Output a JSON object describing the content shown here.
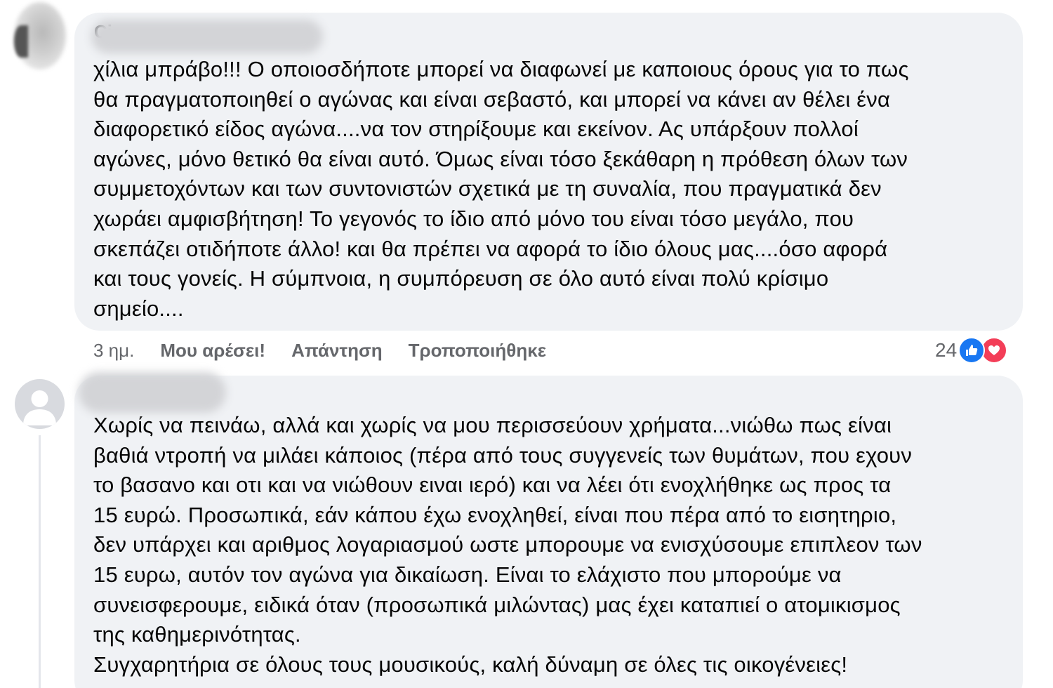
{
  "comments": [
    {
      "author_visible_fragment": "Ci",
      "text": "χίλια μπράβο!!! Ο οποιοσδήποτε μπορεί να διαφωνεί με καποιους όρους για το πως\nθα πραγματοποιηθεί ο αγώνας και είναι σεβαστό, και μπορεί να κάνει αν θέλει ένα\nδιαφορετικό είδος αγώνα....να τον στηρίξουμε και εκείνον. Ας υπάρξουν πολλοί\nαγώνες, μόνο θετικό θα είναι αυτό. Όμως είναι τόσο ξεκάθαρη η πρόθεση όλων των\nσυμμετοχόντων και των συντονιστών σχετικά με τη συναλία, που πραγματικά δεν\nχωράει αμφισβήτηση! Το γεγονός το ίδιο από μόνο του είναι τόσο μεγάλο, που\nσκεπάζει οτιδήποτε άλλο! και θα πρέπει να αφορά το ίδιο όλους μας....όσο αφορά\nκαι τους γονείς. Η σύμπνοια, η συμπόρευση σε όλο αυτό είναι πολύ κρίσιμο\nσημείο....",
      "time": "3 ημ.",
      "like_label": "Μου αρέσει!",
      "reply_label": "Απάντηση",
      "edited_label": "Τροποποιήθηκε",
      "reaction_count": "24",
      "reaction_icons": [
        "like-icon",
        "love-icon"
      ],
      "reaction_colors": {
        "like": "#1877f2",
        "love": "#f33e58"
      }
    },
    {
      "author_visible_fragment": ".",
      "text": "Χωρίς να πεινάω, αλλά και χωρίς να μου περισσεύουν χρήματα...νιώθω πως είναι\nβαθιά ντροπή να μιλάει κάποιος (πέρα από τους συγγενείς των θυμάτων, που εχουν\nτο βασανο και οτι και να νιώθουν ειναι ιερό) και να λέει ότι ενοχλήθηκε ως προς τα\n15 ευρώ. Προσωπικά, εάν κάπου έχω ενοχληθεί, είναι που πέρα από το εισητηριο,\nδεν υπάρχει και αριθμος λογαριασμού ωστε μπορουμε να ενισχύσουμε επιπλεον των\n15 ευρω, αυτόν τον αγώνα για δικαίωση. Είναι το ελάχιστο που μπορούμε να\nσυνεισφερουμε, ειδικά όταν (προσωπικά μιλώντας) μας έχει καταπιεί ο ατομικισμος\nτης καθημερινότητας.\nΣυγχαρητήρια σε όλους τους μουσικούς, καλή δύναμη σε όλες τις οικογένειες!"
    }
  ],
  "colors": {
    "bubble": "#f0f2f5",
    "meta_text": "#65676b",
    "body_text": "#050505"
  }
}
